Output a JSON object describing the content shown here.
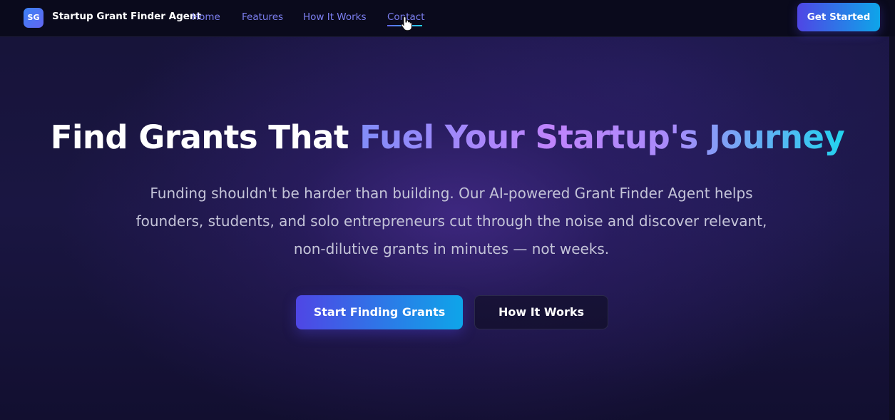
{
  "nav": {
    "logo_text": "SG",
    "brand": "Startup Grant Finder Agent",
    "links": [
      "Home",
      "Features",
      "How It Works",
      "Contact"
    ],
    "active_link": "Contact",
    "cta": "Get Started"
  },
  "hero": {
    "title_plain": "Find Grants That ",
    "title_accent": "Fuel Your Startup's Journey",
    "description": "Funding shouldn't be harder than building. Our AI-powered Grant Finder Agent helps founders, students, and solo entrepreneurs cut through the noise and discover relevant, non-dilutive grants in minutes — not weeks.",
    "primary_button": "Start Finding Grants",
    "secondary_button": "How It Works"
  },
  "colors": {
    "nav_background": "#0a0a1c",
    "nav_link": "#7c7ff0",
    "accent_start": "#4f46e5",
    "accent_end": "#0ea5e9"
  },
  "icons": {
    "cursor": "hand-pointer-icon"
  }
}
